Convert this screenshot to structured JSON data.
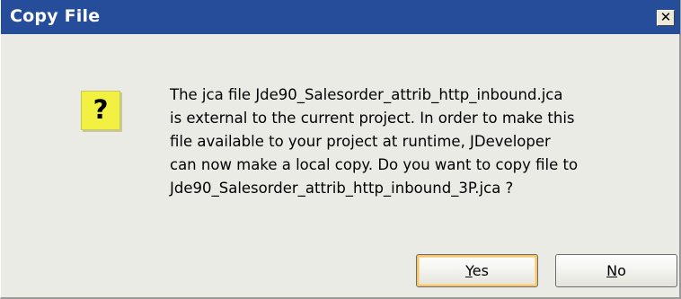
{
  "window": {
    "title": "Copy File",
    "close_glyph": "✕",
    "close_label": "Close"
  },
  "icon": {
    "name": "question-icon",
    "glyph": "?",
    "background": "#f2f040"
  },
  "message": {
    "lines": [
      "The jca file Jde90_Salesorder_attrib_http_inbound.jca",
      "is external to the current project. In order to make this",
      "file available to your project at runtime, JDeveloper",
      "can now make a local copy. Do you want to copy file to",
      "Jde90_Salesorder_attrib_http_inbound_3P.jca ?"
    ]
  },
  "buttons": {
    "yes": {
      "mnemonic": "Y",
      "rest": "es",
      "default": true
    },
    "no": {
      "mnemonic": "N",
      "rest": "o",
      "default": false
    }
  },
  "colors": {
    "titlebar": "#264d9a",
    "dialog_background": "#ebebe6",
    "default_button_focus": "#f5c66a"
  }
}
